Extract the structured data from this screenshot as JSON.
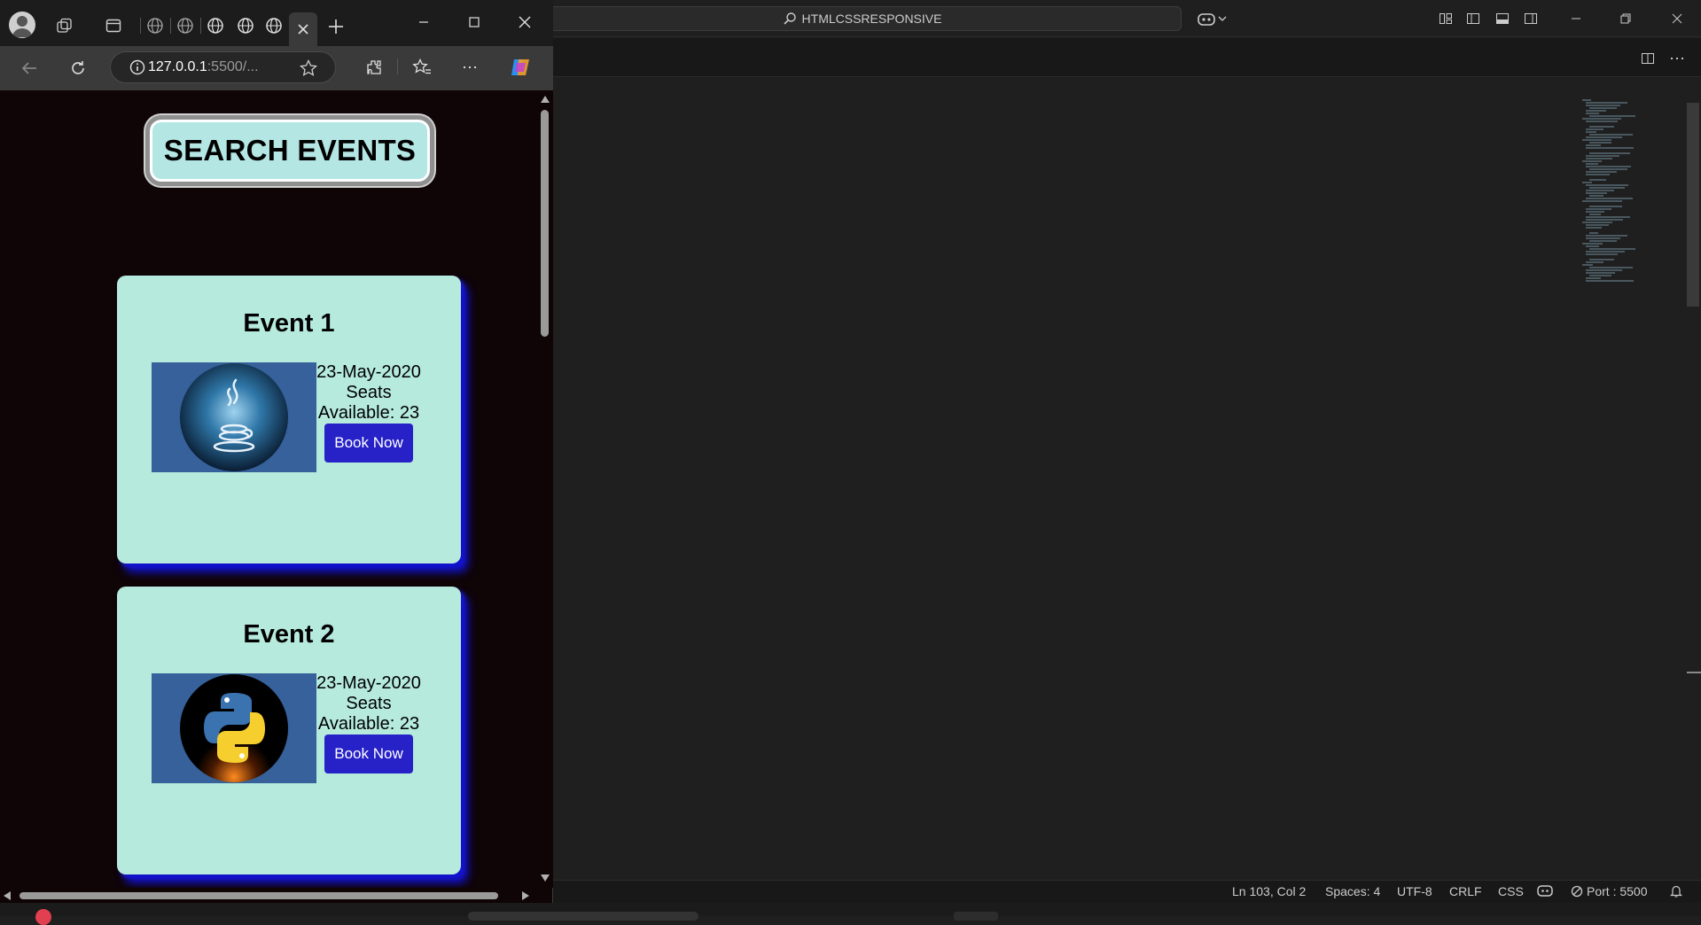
{
  "vscode": {
    "command_center_label": "HTMLCSSRESPONSIVE",
    "status": {
      "position": "Ln 103, Col 2",
      "spaces": "Spaces: 4",
      "encoding": "UTF-8",
      "eol": "CRLF",
      "language": "CSS",
      "port": "Port : 5500"
    }
  },
  "browser": {
    "url_host": "127.0.0.1",
    "url_rest": ":5500/..."
  },
  "page": {
    "search_button_label": "SEARCH EVENTS",
    "events": [
      {
        "title": "Event 1",
        "date": "23-May-2020",
        "seats_label": "Seats",
        "available": "Available: 23",
        "button": "Book Now",
        "logo": "java-icon"
      },
      {
        "title": "Event 2",
        "date": "23-May-2020",
        "seats_label": "Seats",
        "available": "Available: 23",
        "button": "Book Now",
        "logo": "python-icon"
      }
    ]
  }
}
